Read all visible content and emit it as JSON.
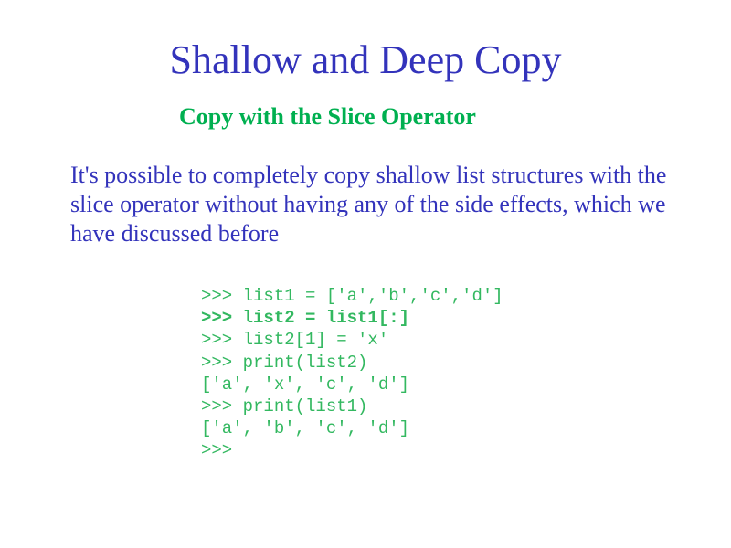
{
  "slide": {
    "title": "Shallow and Deep Copy",
    "subtitle": "Copy with the Slice Operator",
    "body": "It's possible to completely copy shallow list structures with the slice operator without having any of the side effects, which we have discussed before",
    "code_lines": [
      {
        "text": ">>> list1 = ['a','b','c','d']",
        "bold": false
      },
      {
        "text": ">>> list2 = list1[:]",
        "bold": true
      },
      {
        "text": ">>> list2[1] = 'x'",
        "bold": false
      },
      {
        "text": ">>> print(list2)",
        "bold": false
      },
      {
        "text": "['a', 'x', 'c', 'd']",
        "bold": false
      },
      {
        "text": ">>> print(list1)",
        "bold": false
      },
      {
        "text": "['a', 'b', 'c', 'd']",
        "bold": false
      },
      {
        "text": ">>>",
        "bold": false
      }
    ]
  },
  "colors": {
    "title": "#3333bb",
    "subtitle": "#00b050",
    "body": "#3333bb",
    "code": "#33b860"
  }
}
